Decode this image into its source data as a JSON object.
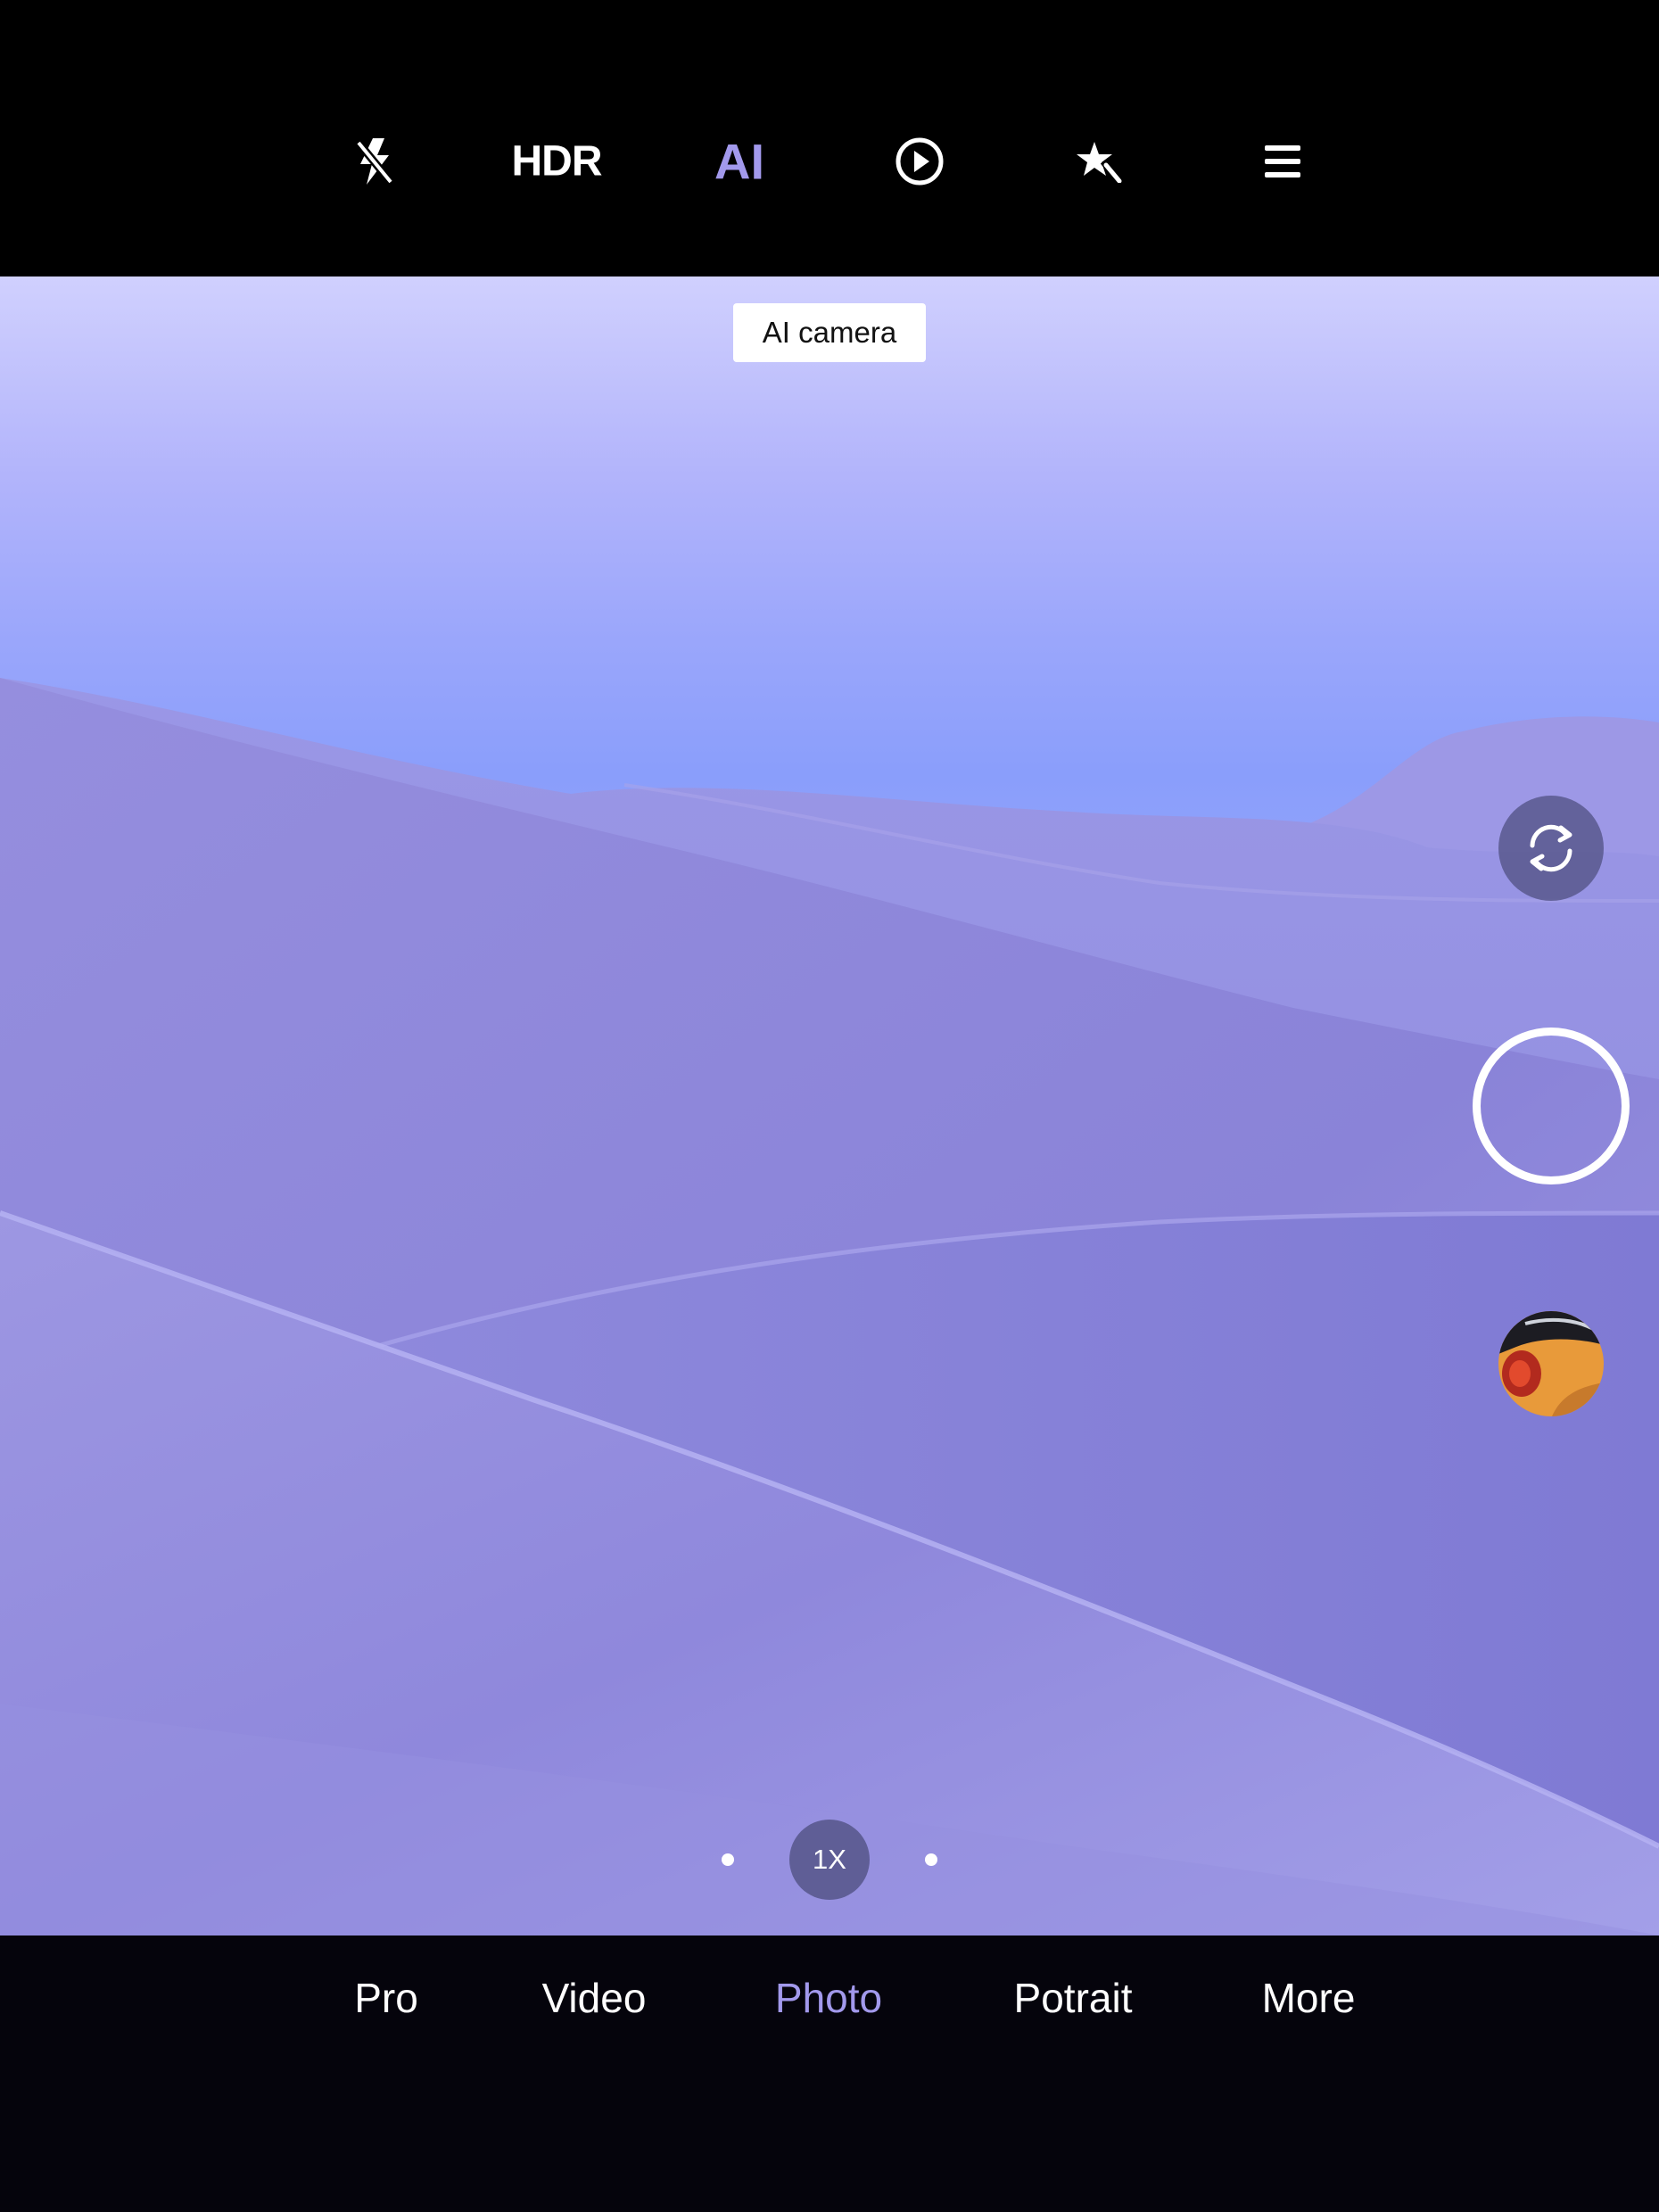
{
  "top_bar": {
    "flash_icon": "flash-off-icon",
    "hdr_label": "HDR",
    "ai_label": "AI",
    "motion_icon": "live-photo-icon",
    "filter_icon": "magic-star-icon",
    "menu_icon": "menu-icon"
  },
  "viewfinder": {
    "ai_tooltip": "AI camera",
    "zoom_label": "1X",
    "switch_camera_icon": "switch-camera-icon",
    "shutter_icon": "shutter-icon",
    "gallery_icon": "gallery-thumbnail"
  },
  "modes": [
    {
      "label": "Pro"
    },
    {
      "label": "Video"
    },
    {
      "label": "Photo",
      "active": true
    },
    {
      "label": "Potrait"
    },
    {
      "label": "More"
    }
  ],
  "colors": {
    "accent": "#a299ec",
    "bar_background": "#000000",
    "sky": "#9aa6fb",
    "dune": "#8c86dc"
  }
}
